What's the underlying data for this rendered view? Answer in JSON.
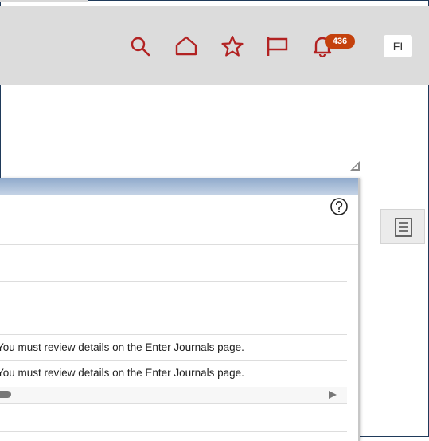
{
  "header": {
    "notification_count": "436",
    "user_initials": "FI",
    "accent_color": "#b22222",
    "badge_color": "#c4410c"
  },
  "icons": [
    "search-icon",
    "home-icon",
    "star-icon",
    "flag-icon",
    "bell-icon",
    "help-icon",
    "document-list-icon"
  ],
  "content": {
    "messages": [
      "You must review details on the Enter Journals page.",
      "You must review details on the Enter Journals page."
    ]
  }
}
